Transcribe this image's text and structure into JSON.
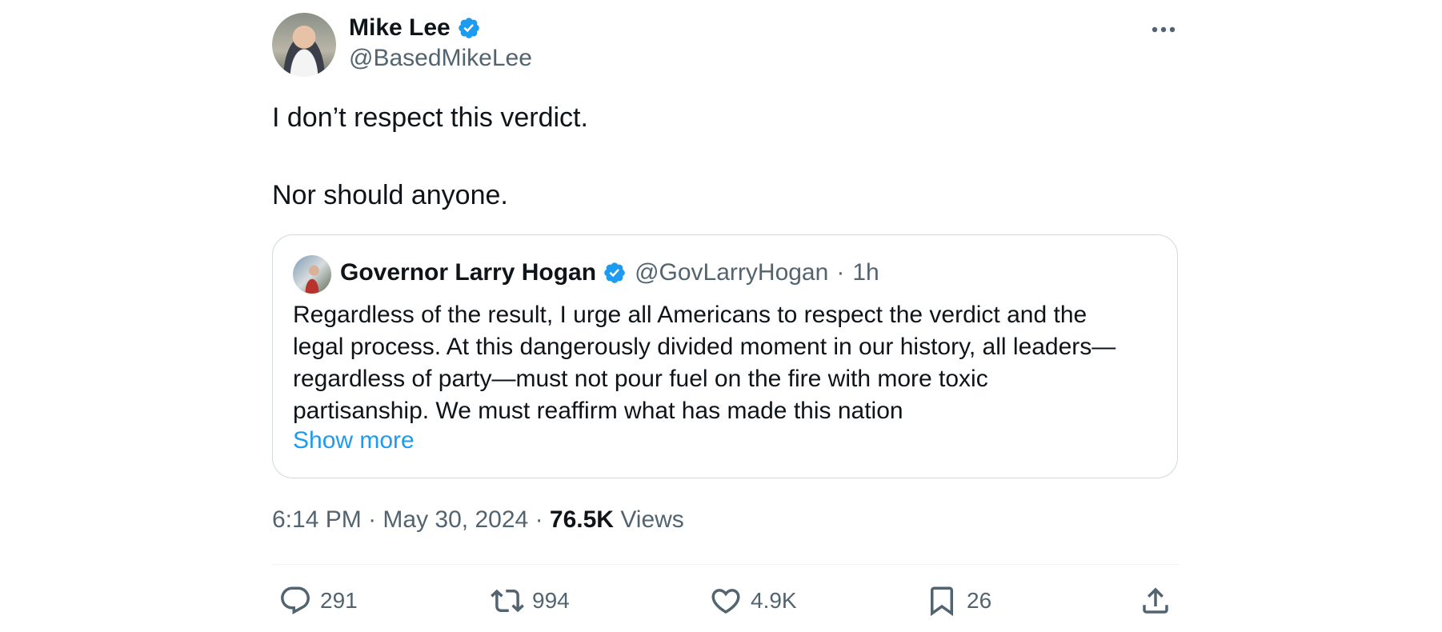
{
  "author": {
    "name": "Mike Lee",
    "handle": "@BasedMikeLee",
    "verified_icon": "verified-badge-icon"
  },
  "tweet": {
    "line1": "I don’t respect this verdict.",
    "line2": "Nor should anyone."
  },
  "quote": {
    "name": "Governor Larry Hogan",
    "handle": "@GovLarryHogan",
    "separator": "·",
    "time": "1h",
    "lines": [
      "Regardless of the result, I urge all Americans to respect the verdict and the",
      "legal process. At this dangerously divided moment in our history, all leaders—",
      "regardless of party—must not pour fuel on the fire with more toxic",
      "partisanship. We must reaffirm what has made this nation"
    ],
    "show_more": "Show more"
  },
  "meta": {
    "time": "6:14 PM",
    "sep1": "·",
    "date": "May 30, 2024",
    "sep2": "·",
    "views_count": "76.5K",
    "views_label": "Views"
  },
  "actions": {
    "replies": "291",
    "retweets": "994",
    "likes": "4.9K",
    "bookmarks": "26"
  },
  "colors": {
    "accent": "#1d9bf0",
    "text": "#0f1419",
    "secondary": "#536471",
    "border": "#cfd9de"
  }
}
